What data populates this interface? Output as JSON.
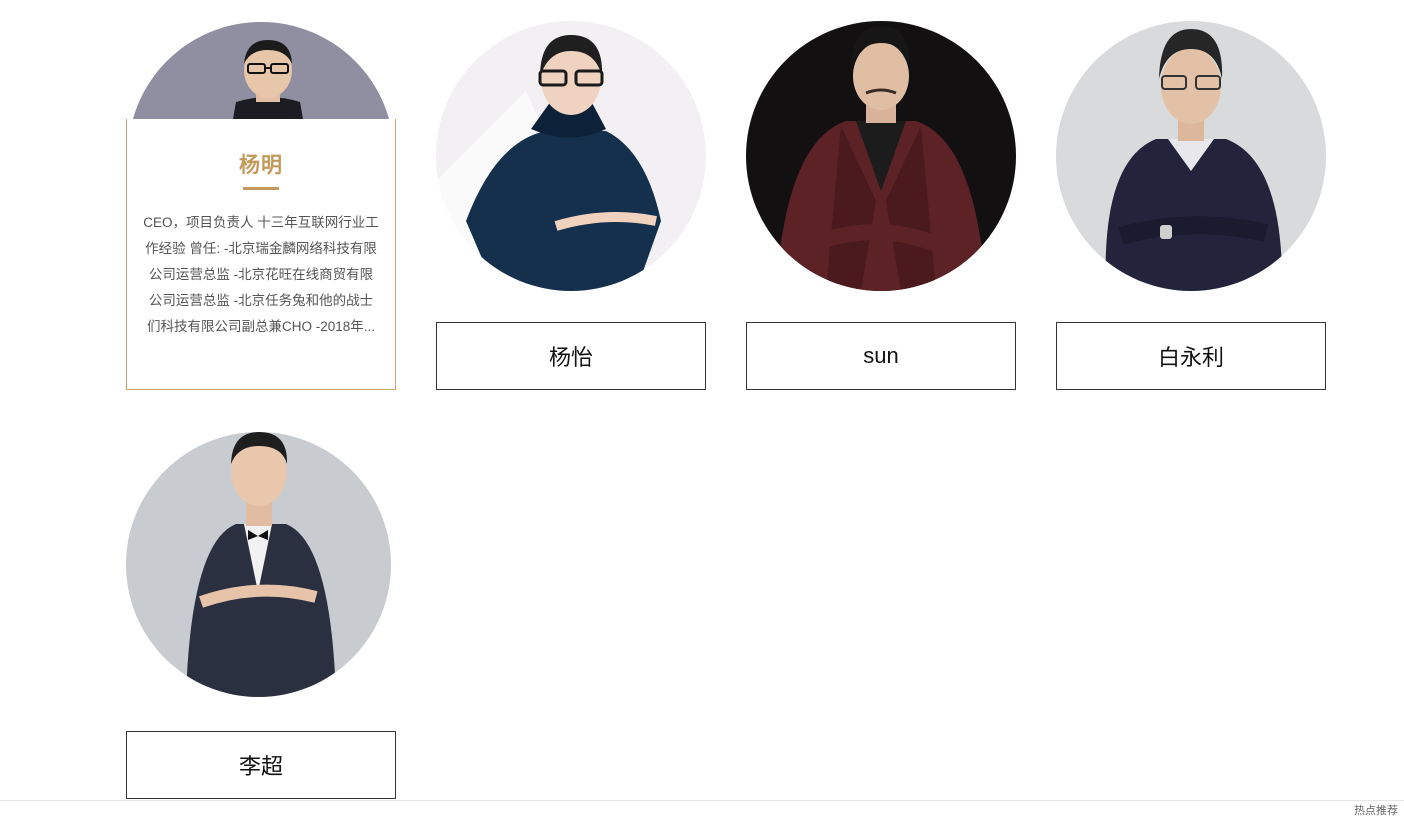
{
  "members": [
    {
      "name": "杨明",
      "bio": "CEO，项目负责人 十三年互联网行业工作经验 曾任: -北京瑞金麟网络科技有限公司运营总监 -北京花旺在线商贸有限公司运营总监 -北京任务兔和他的战士们科技有限公司副总兼CHO -2018年..."
    },
    {
      "name": "杨怡"
    },
    {
      "name": "sun"
    },
    {
      "name": "白永利"
    },
    {
      "name": "李超"
    }
  ],
  "footer": {
    "link_text": "热点推荐"
  },
  "colors": {
    "accent": "#c4995a",
    "detail_border": "#c8a46a",
    "name_border": "#333333"
  }
}
